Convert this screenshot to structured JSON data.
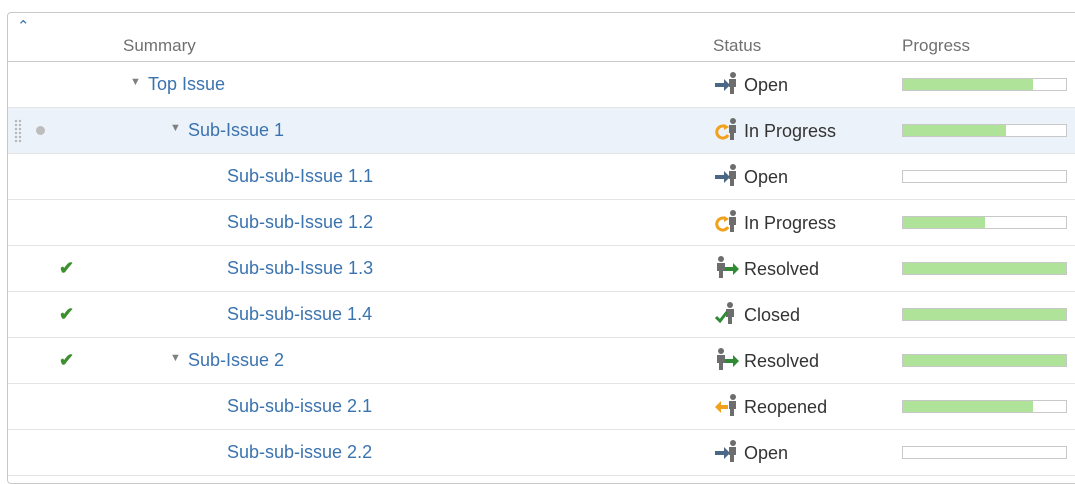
{
  "table": {
    "columns": {
      "summary": "Summary",
      "status": "Status",
      "progress": "Progress"
    },
    "rows": [
      {
        "summary": "Top Issue",
        "status": "Open",
        "status_icon": "open-status-icon",
        "progress": 0.8,
        "resolved": false,
        "expandable": true,
        "level": 0
      },
      {
        "summary": "Sub-Issue 1",
        "status": "In Progress",
        "status_icon": "in-progress-status-icon",
        "progress": 0.63,
        "resolved": false,
        "expandable": true,
        "level": 1,
        "selected": true
      },
      {
        "summary": "Sub-sub-Issue 1.1",
        "status": "Open",
        "status_icon": "open-status-icon",
        "progress": 0,
        "resolved": false,
        "expandable": false,
        "level": 2
      },
      {
        "summary": "Sub-sub-Issue 1.2",
        "status": "In Progress",
        "status_icon": "in-progress-status-icon",
        "progress": 0.5,
        "resolved": false,
        "expandable": false,
        "level": 2
      },
      {
        "summary": "Sub-sub-Issue 1.3",
        "status": "Resolved",
        "status_icon": "resolved-status-icon",
        "progress": 1,
        "resolved": true,
        "expandable": false,
        "level": 2
      },
      {
        "summary": "Sub-sub-issue 1.4",
        "status": "Closed",
        "status_icon": "closed-status-icon",
        "progress": 1,
        "resolved": true,
        "expandable": false,
        "level": 2
      },
      {
        "summary": "Sub-Issue 2",
        "status": "Resolved",
        "status_icon": "resolved-status-icon",
        "progress": 1,
        "resolved": true,
        "expandable": true,
        "level": 1
      },
      {
        "summary": "Sub-sub-issue 2.1",
        "status": "Reopened",
        "status_icon": "reopened-status-icon",
        "progress": 0.8,
        "resolved": false,
        "expandable": false,
        "level": 2
      },
      {
        "summary": "Sub-sub-issue 2.2",
        "status": "Open",
        "status_icon": "open-status-icon",
        "progress": 0,
        "resolved": false,
        "expandable": false,
        "level": 2
      }
    ]
  },
  "colors": {
    "link": "#3b73af",
    "progress_fill": "#b0e39a",
    "selected_row": "#ebf2f9",
    "check": "#3e8f2e",
    "status_open_arrow": "#4a6785",
    "status_in_progress": "#f0a21f",
    "status_resolved_arrow": "#2f8a33",
    "status_reopened": "#f0a21f"
  }
}
